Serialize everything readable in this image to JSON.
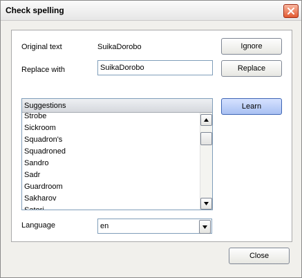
{
  "window": {
    "title": "Check spelling"
  },
  "form": {
    "original_label": "Original text",
    "original_value": "SuikaDorobo",
    "replace_label": "Replace with",
    "replace_value": "SuikaDorobo",
    "language_label": "Language",
    "language_value": "en"
  },
  "buttons": {
    "ignore": "Ignore",
    "replace": "Replace",
    "learn": "Learn",
    "close": "Close"
  },
  "suggestions": {
    "header": "Suggestions",
    "items": [
      "Strobe",
      "Sickroom",
      "Squadron's",
      "Squadroned",
      "Sandro",
      "Sadr",
      "Guardroom",
      "Sakharov",
      "Satori"
    ]
  },
  "colors": {
    "accent": "#a9c0f2",
    "close_button": "#e25a32"
  },
  "icons": {
    "close": "close-icon",
    "scroll_up": "arrow-up-icon",
    "scroll_down": "arrow-down-icon",
    "dropdown": "chevron-down-icon"
  }
}
